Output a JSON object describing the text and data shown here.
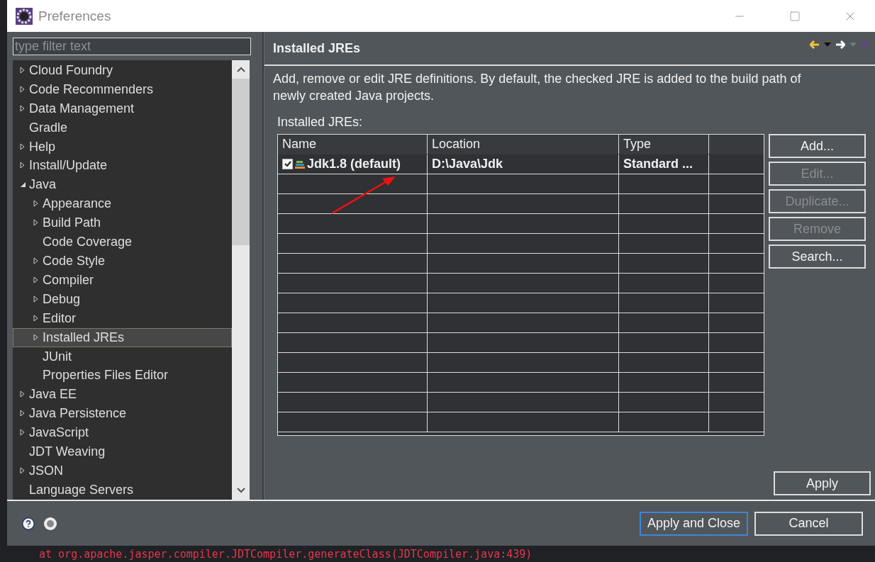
{
  "window": {
    "title": "Preferences"
  },
  "filter": {
    "placeholder": "type filter text"
  },
  "tree": [
    {
      "label": "Cloud Foundry",
      "expanded": false,
      "selected": false
    },
    {
      "label": "Code Recommenders",
      "expanded": false,
      "selected": false
    },
    {
      "label": "Data Management",
      "expanded": false,
      "selected": false
    },
    {
      "label": "Gradle",
      "selected": false
    },
    {
      "label": "Help",
      "expanded": false,
      "selected": false
    },
    {
      "label": "Install/Update",
      "expanded": false,
      "selected": false
    },
    {
      "label": "Java",
      "expanded": true,
      "selected": false,
      "children": [
        {
          "label": "Appearance",
          "expanded": false,
          "selected": false
        },
        {
          "label": "Build Path",
          "expanded": false,
          "selected": false
        },
        {
          "label": "Code Coverage",
          "selected": false
        },
        {
          "label": "Code Style",
          "expanded": false,
          "selected": false
        },
        {
          "label": "Compiler",
          "expanded": false,
          "selected": false
        },
        {
          "label": "Debug",
          "expanded": false,
          "selected": false
        },
        {
          "label": "Editor",
          "expanded": false,
          "selected": false
        },
        {
          "label": "Installed JREs",
          "expanded": false,
          "selected": true
        },
        {
          "label": "JUnit",
          "selected": false
        },
        {
          "label": "Properties Files Editor",
          "selected": false
        }
      ]
    },
    {
      "label": "Java EE",
      "expanded": false,
      "selected": false
    },
    {
      "label": "Java Persistence",
      "expanded": false,
      "selected": false
    },
    {
      "label": "JavaScript",
      "expanded": false,
      "selected": false
    },
    {
      "label": "JDT Weaving",
      "selected": false
    },
    {
      "label": "JSON",
      "expanded": false,
      "selected": false
    },
    {
      "label": "Language Servers",
      "selected": false
    }
  ],
  "page": {
    "title": "Installed JREs",
    "description": "Add, remove or edit JRE definitions. By default, the checked JRE is added to the build path of newly created Java projects.",
    "table_label": "Installed JREs:"
  },
  "table": {
    "columns": [
      "Name",
      "Location",
      "Type"
    ],
    "rows": [
      {
        "checked": true,
        "name": "Jdk1.8 (default)",
        "location": "D:\\Java\\Jdk",
        "type": "Standard ..."
      }
    ]
  },
  "side_buttons": [
    {
      "label": "Add...",
      "disabled": false
    },
    {
      "label": "Edit...",
      "disabled": true
    },
    {
      "label": "Duplicate...",
      "disabled": true
    },
    {
      "label": "Remove",
      "disabled": true
    },
    {
      "label": "Search...",
      "disabled": false
    }
  ],
  "apply_button": "Apply",
  "footer_buttons": [
    {
      "label": "Apply and Close",
      "selected": true
    },
    {
      "label": "Cancel",
      "selected": false
    }
  ],
  "background_code": "at org.apache.jasper.compiler.JDTCompiler.generateClass(JDTCompiler.java:439)"
}
